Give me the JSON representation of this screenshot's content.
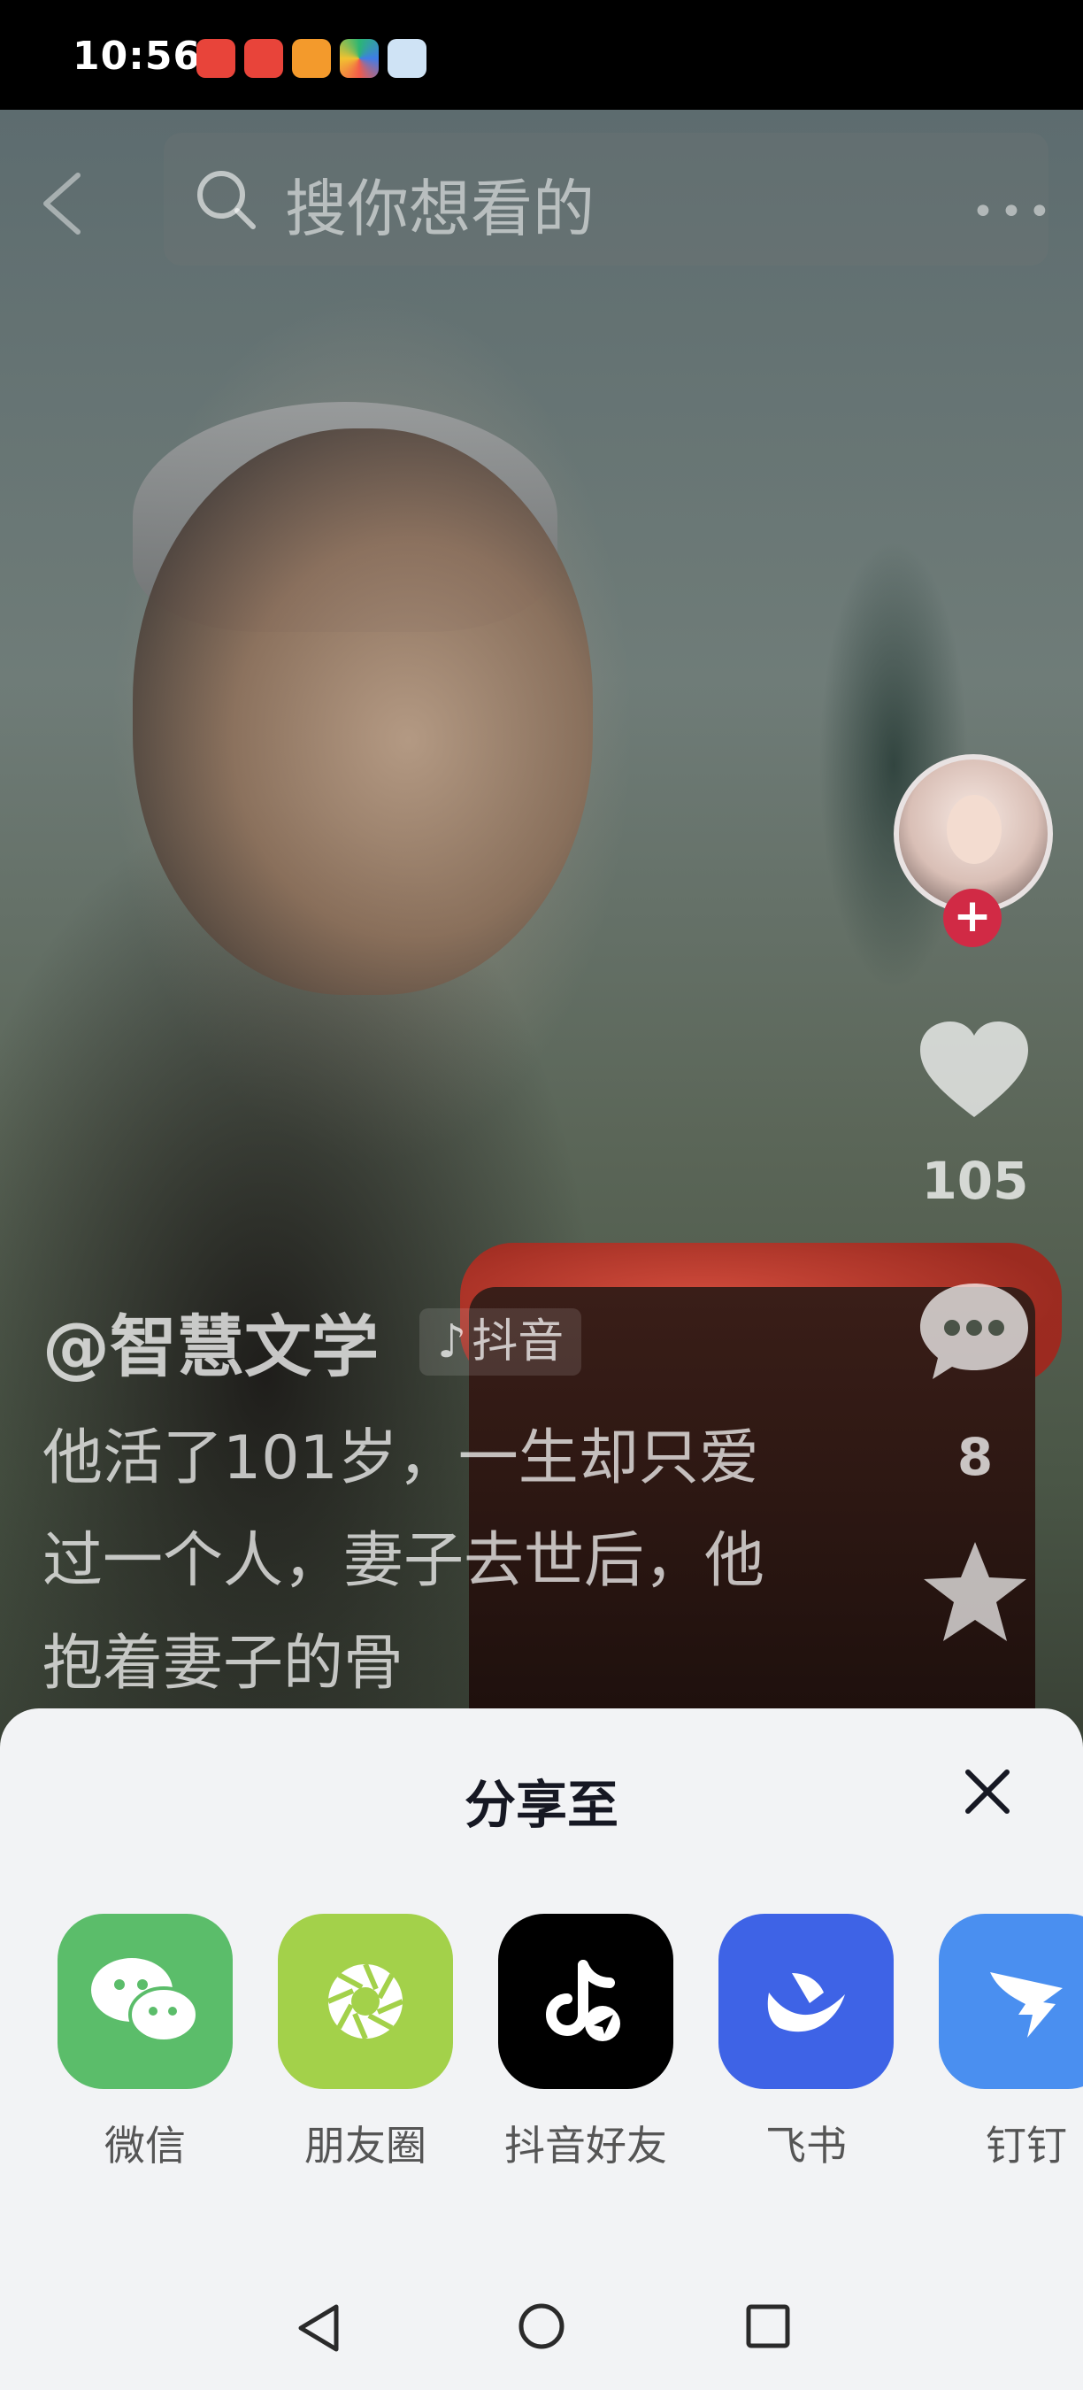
{
  "status_bar": {
    "time": "10:56"
  },
  "search": {
    "placeholder": "搜你想看的"
  },
  "video": {
    "author": "@智慧文学",
    "brand_badge": "抖音",
    "caption": "他活了101岁，一生却只爱过一个人，妻子去世后，他抱着妻子的骨",
    "likes": "105",
    "comments": "8"
  },
  "share_sheet": {
    "title": "分享至",
    "targets": [
      {
        "label": "微信",
        "color": "#5bbd6a",
        "icon": "wechat-icon"
      },
      {
        "label": "朋友圈",
        "color": "#a3d14a",
        "icon": "moments-icon"
      },
      {
        "label": "抖音好友",
        "color": "#000000",
        "icon": "douyin-friends-icon"
      },
      {
        "label": "飞书",
        "color": "#3e63e6",
        "icon": "feishu-icon"
      },
      {
        "label": "钉钉",
        "color": "#4a8ff0",
        "icon": "dingtalk-icon"
      }
    ]
  }
}
